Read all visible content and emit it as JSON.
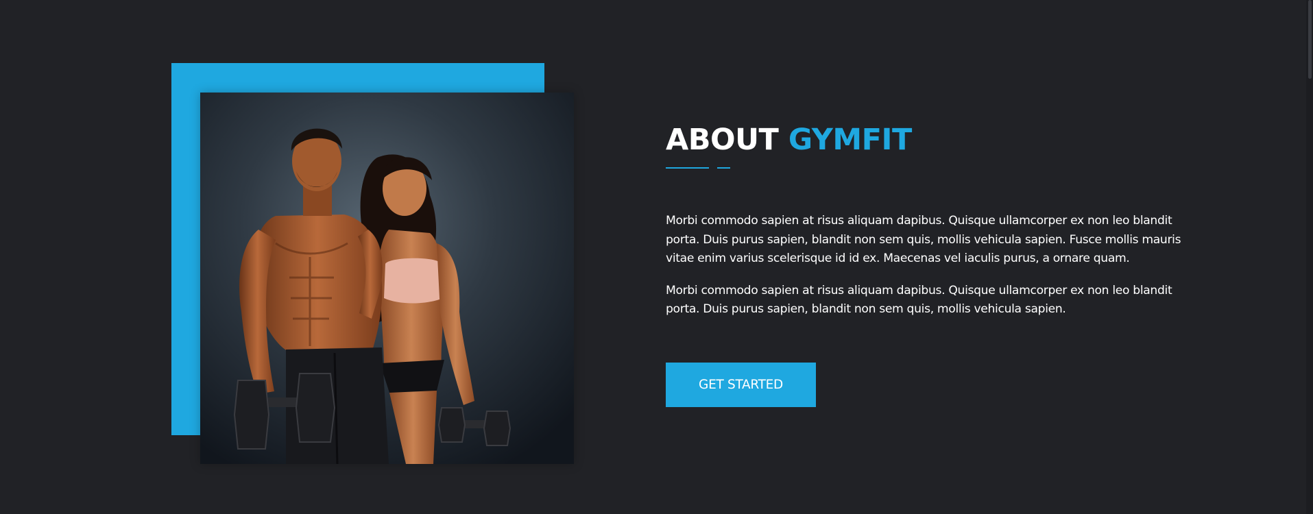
{
  "about": {
    "title_main": "ABOUT",
    "title_accent": "GYMFIT",
    "paragraph_1": "Morbi commodo sapien at risus aliquam dapibus. Quisque ullamcorper ex non leo blandit porta. Duis purus sapien, blandit non sem quis, mollis vehicula sapien. Fusce mollis mauris vitae enim varius scelerisque id id ex. Maecenas vel iaculis purus, a ornare quam.",
    "paragraph_2": "Morbi commodo sapien at risus aliquam dapibus. Quisque ullamcorper ex non leo blandit porta. Duis purus sapien, blandit non sem quis, mollis vehicula sapien.",
    "cta_label": "GET STARTED"
  },
  "colors": {
    "background": "#212226",
    "accent": "#1fa8e0",
    "text": "#ffffff"
  }
}
